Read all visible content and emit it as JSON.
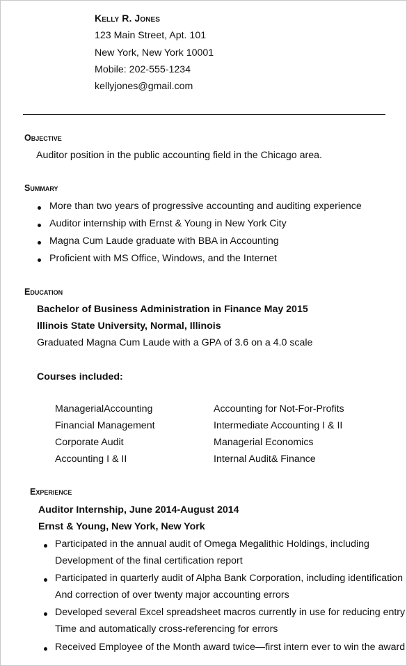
{
  "header": {
    "name": "Kelly R. Jones",
    "address_line1": "123 Main Street, Apt. 101",
    "address_line2": "New York, New York 10001",
    "phone": "Mobile: 202-555-1234",
    "email": "kellyjones@gmail.com"
  },
  "objective": {
    "heading": "Objective",
    "text": "Auditor position in the public accounting field in the Chicago area."
  },
  "summary": {
    "heading": "Summary",
    "items": [
      "More than two years of progressive accounting and auditing experience",
      "Auditor internship with Ernst & Young in New York City",
      "Magna Cum Laude graduate with BBA in Accounting",
      "Proficient with MS Office, Windows, and the Internet"
    ]
  },
  "education": {
    "heading": "Education",
    "degree": "Bachelor of Business Administration in Finance May 2015",
    "school": "Illinois State University, Normal, Illinois",
    "honors": "Graduated Magna Cum Laude with a GPA of 3.6 on a 4.0 scale",
    "courses_heading": "Courses included:",
    "courses_left": [
      "ManagerialAccounting",
      "Financial Management",
      "Corporate Audit",
      "Accounting I & II"
    ],
    "courses_right": [
      "Accounting for Not-For-Profits",
      "Intermediate Accounting I & II",
      "Managerial Economics",
      "Internal Audit& Finance"
    ]
  },
  "experience": {
    "heading": "Experience",
    "title": "Auditor Internship, June 2014-August 2014",
    "employer": "Ernst & Young, New York, New York",
    "items": [
      {
        "line1": "Participated in the annual audit of Omega Megalithic Holdings, including",
        "line2": "Development of the final certification report"
      },
      {
        "line1": "Participated in quarterly audit of Alpha Bank Corporation, including identification",
        "line2": "And correction of over twenty major accounting errors"
      },
      {
        "line1": "Developed several Excel spreadsheet macros currently in use for reducing entry",
        "line2": "Time and automatically  cross-referencing for errors"
      },
      {
        "line1": "Received Employee of the Month award twice—first intern ever to win the award",
        "line2": ""
      }
    ]
  }
}
